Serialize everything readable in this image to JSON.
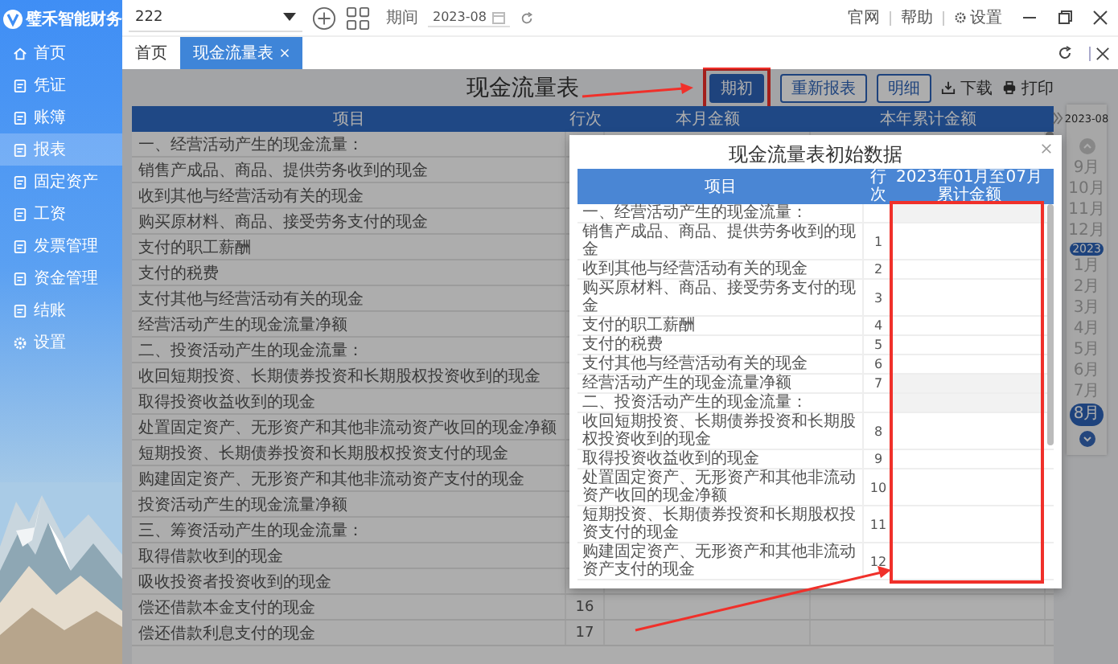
{
  "app": {
    "logo": "璧禾智能财务"
  },
  "sidebar": {
    "items": [
      {
        "label": "首页",
        "kind": "home",
        "selected": false
      },
      {
        "label": "凭证",
        "kind": "module",
        "selected": false
      },
      {
        "label": "账簿",
        "kind": "module",
        "selected": false
      },
      {
        "label": "报表",
        "kind": "module",
        "selected": true
      },
      {
        "label": "固定资产",
        "kind": "module",
        "selected": false
      },
      {
        "label": "工资",
        "kind": "module",
        "selected": false
      },
      {
        "label": "发票管理",
        "kind": "module",
        "selected": false
      },
      {
        "label": "资金管理",
        "kind": "module",
        "selected": false
      },
      {
        "label": "结账",
        "kind": "module",
        "selected": false
      },
      {
        "label": "设置",
        "kind": "settings",
        "selected": false
      }
    ]
  },
  "topbar": {
    "account": "222",
    "period_label": "期间",
    "period": "2023-08",
    "links": [
      {
        "label": "官网",
        "kind": "text"
      },
      {
        "label": "帮助",
        "kind": "text"
      },
      {
        "label": "设置",
        "kind": "settings"
      }
    ]
  },
  "tabs": [
    {
      "label": "首页",
      "selected": false,
      "closable": false
    },
    {
      "label": "现金流量表",
      "selected": true,
      "closable": true
    }
  ],
  "report": {
    "title": "现金流量表",
    "actions": [
      {
        "label": "期初",
        "kind": "primary",
        "highlighted": true
      },
      {
        "label": "重新报表",
        "kind": "outline",
        "highlighted": false
      },
      {
        "label": "明细",
        "kind": "outline",
        "highlighted": false
      },
      {
        "label": "下载",
        "kind": "download",
        "highlighted": false
      },
      {
        "label": "打印",
        "kind": "print",
        "highlighted": false
      }
    ],
    "columns": [
      "项目",
      "行次",
      "本月金额",
      "本年累计金额"
    ],
    "rows": [
      {
        "item": "一、经营活动产生的现金流量："
      },
      {
        "item": "销售产成品、商品、提供劳务收到的现金"
      },
      {
        "item": "收到其他与经营活动有关的现金"
      },
      {
        "item": "购买原材料、商品、接受劳务支付的现金"
      },
      {
        "item": "支付的职工薪酬"
      },
      {
        "item": "支付的税费"
      },
      {
        "item": "支付其他与经营活动有关的现金"
      },
      {
        "item": "经营活动产生的现金流量净额"
      },
      {
        "item": "二、投资活动产生的现金流量："
      },
      {
        "item": "收回短期投资、长期债券投资和长期股权投资收到的现金"
      },
      {
        "item": "取得投资收益收到的现金"
      },
      {
        "item": "处置固定资产、无形资产和其他非流动资产收回的现金净额"
      },
      {
        "item": "短期投资、长期债券投资和长期股权投资支付的现金"
      },
      {
        "item": "购建固定资产、无形资产和其他非流动资产支付的现金"
      },
      {
        "item": "投资活动产生的现金流量净额"
      },
      {
        "item": "三、筹资活动产生的现金流量："
      },
      {
        "item": "取得借款收到的现金"
      },
      {
        "item": "吸收投资者投资收到的现金"
      },
      {
        "item": "偿还借款本金支付的现金",
        "line": "16"
      },
      {
        "item": "偿还借款利息支付的现金",
        "line": "17"
      }
    ]
  },
  "timeline": {
    "current": "2023-08",
    "items": [
      {
        "kind": "month",
        "label": "9月",
        "selected": false
      },
      {
        "kind": "month",
        "label": "10月",
        "selected": false
      },
      {
        "kind": "month",
        "label": "11月",
        "selected": false
      },
      {
        "kind": "month",
        "label": "12月",
        "selected": false
      },
      {
        "kind": "year",
        "label": "2023"
      },
      {
        "kind": "month",
        "label": "1月",
        "selected": false
      },
      {
        "kind": "month",
        "label": "2月",
        "selected": false
      },
      {
        "kind": "month",
        "label": "3月",
        "selected": false
      },
      {
        "kind": "month",
        "label": "4月",
        "selected": false
      },
      {
        "kind": "month",
        "label": "5月",
        "selected": false
      },
      {
        "kind": "month",
        "label": "6月",
        "selected": false
      },
      {
        "kind": "month",
        "label": "7月",
        "selected": false
      },
      {
        "kind": "month",
        "label": "8月",
        "selected": true
      }
    ]
  },
  "dialog": {
    "title": "现金流量表初始数据",
    "columns": [
      "项目",
      "行次",
      "2023年01月至07月累计金额"
    ],
    "rows": [
      {
        "kind": "section",
        "item": "一、经营活动产生的现金流量："
      },
      {
        "kind": "item",
        "item": "销售产成品、商品、提供劳务收到的现金",
        "line": "1"
      },
      {
        "kind": "item",
        "item": "收到其他与经营活动有关的现金",
        "line": "2"
      },
      {
        "kind": "item",
        "item": "购买原材料、商品、接受劳务支付的现金",
        "line": "3"
      },
      {
        "kind": "item",
        "item": "支付的职工薪酬",
        "line": "4"
      },
      {
        "kind": "item",
        "item": "支付的税费",
        "line": "5"
      },
      {
        "kind": "item",
        "item": "支付其他与经营活动有关的现金",
        "line": "6"
      },
      {
        "kind": "total",
        "item": "经营活动产生的现金流量净额",
        "line": "7"
      },
      {
        "kind": "section",
        "item": "二、投资活动产生的现金流量："
      },
      {
        "kind": "item",
        "item": "收回短期投资、长期债券投资和长期股权投资收到的现金",
        "line": "8"
      },
      {
        "kind": "item",
        "item": "取得投资收益收到的现金",
        "line": "9"
      },
      {
        "kind": "item",
        "item": "处置固定资产、无形资产和其他非流动资产收回的现金净额",
        "line": "10"
      },
      {
        "kind": "item",
        "item": "短期投资、长期债券投资和长期股权投资支付的现金",
        "line": "11"
      },
      {
        "kind": "item",
        "item": "购建固定资产、无形资产和其他非流动资产支付的现金",
        "line": "12"
      }
    ]
  }
}
